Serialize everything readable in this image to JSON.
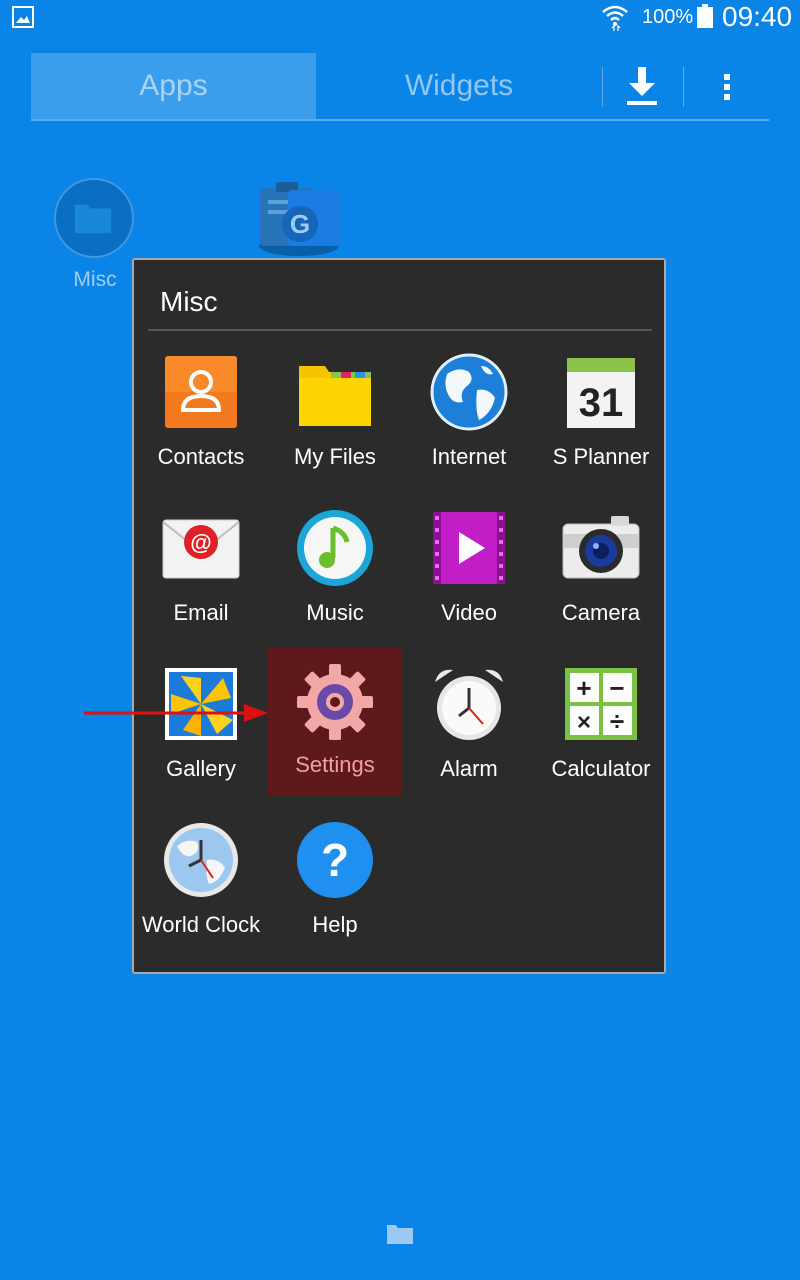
{
  "status_bar": {
    "battery_percent": "100%",
    "time": "09:40",
    "left_icon": "image-icon",
    "wifi_icon": "wifi-icon",
    "battery_icon": "battery-icon"
  },
  "tabs": [
    {
      "label": "Apps",
      "selected": true
    },
    {
      "label": "Widgets",
      "selected": false
    }
  ],
  "toolbar": {
    "download_icon": "download-icon",
    "menu_icon": "more-vertical-icon"
  },
  "background": {
    "folder_label": "Misc"
  },
  "folder_popup": {
    "title": "Misc",
    "apps": [
      {
        "label": "Contacts",
        "icon": "contacts-icon"
      },
      {
        "label": "My Files",
        "icon": "folder-files-icon"
      },
      {
        "label": "Internet",
        "icon": "globe-icon"
      },
      {
        "label": "S Planner",
        "icon": "calendar-icon",
        "icon_text": "31"
      },
      {
        "label": "Email",
        "icon": "email-icon",
        "icon_text": "@"
      },
      {
        "label": "Music",
        "icon": "music-note-icon"
      },
      {
        "label": "Video",
        "icon": "video-play-icon"
      },
      {
        "label": "Camera",
        "icon": "camera-icon"
      },
      {
        "label": "Gallery",
        "icon": "gallery-icon"
      },
      {
        "label": "Settings",
        "icon": "gear-icon",
        "highlighted": true
      },
      {
        "label": "Alarm",
        "icon": "alarm-clock-icon"
      },
      {
        "label": "Calculator",
        "icon": "calculator-icon",
        "icon_text": [
          "+",
          "−",
          "×",
          "÷"
        ]
      },
      {
        "label": "World Clock",
        "icon": "world-clock-icon"
      },
      {
        "label": "Help",
        "icon": "help-icon",
        "icon_text": "?"
      }
    ]
  },
  "annotation": {
    "arrow_color": "#e01010",
    "points_to": "Settings"
  },
  "colors": {
    "background": "#0a84e6",
    "popup": "#2b2b2b",
    "highlight": "#5e1a1a"
  }
}
